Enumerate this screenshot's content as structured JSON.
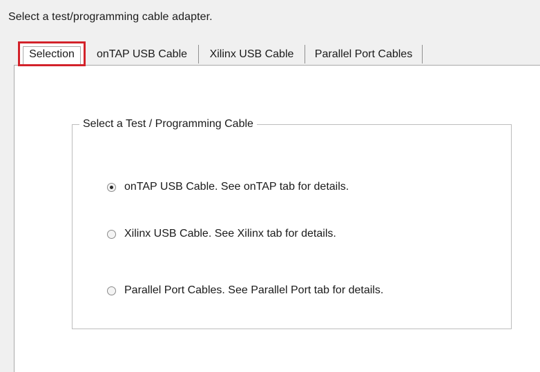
{
  "dialog": {
    "instruction": "Select a test/programming cable adapter."
  },
  "tabs": [
    {
      "label": "Selection",
      "active": true
    },
    {
      "label": "onTAP USB Cable",
      "active": false
    },
    {
      "label": "Xilinx USB Cable",
      "active": false
    },
    {
      "label": "Parallel Port Cables",
      "active": false
    }
  ],
  "group": {
    "title": "Select a Test / Programming Cable",
    "options": [
      {
        "label": "onTAP USB Cable.  See onTAP tab for details.",
        "checked": true
      },
      {
        "label": "Xilinx USB Cable.  See Xilinx tab for details.",
        "checked": false
      },
      {
        "label": "Parallel Port Cables.  See Parallel Port tab for details.",
        "checked": false
      }
    ]
  },
  "colors": {
    "highlight_border": "#d3222a",
    "dialog_background": "#f0f0f0",
    "panel_background": "#ffffff"
  }
}
